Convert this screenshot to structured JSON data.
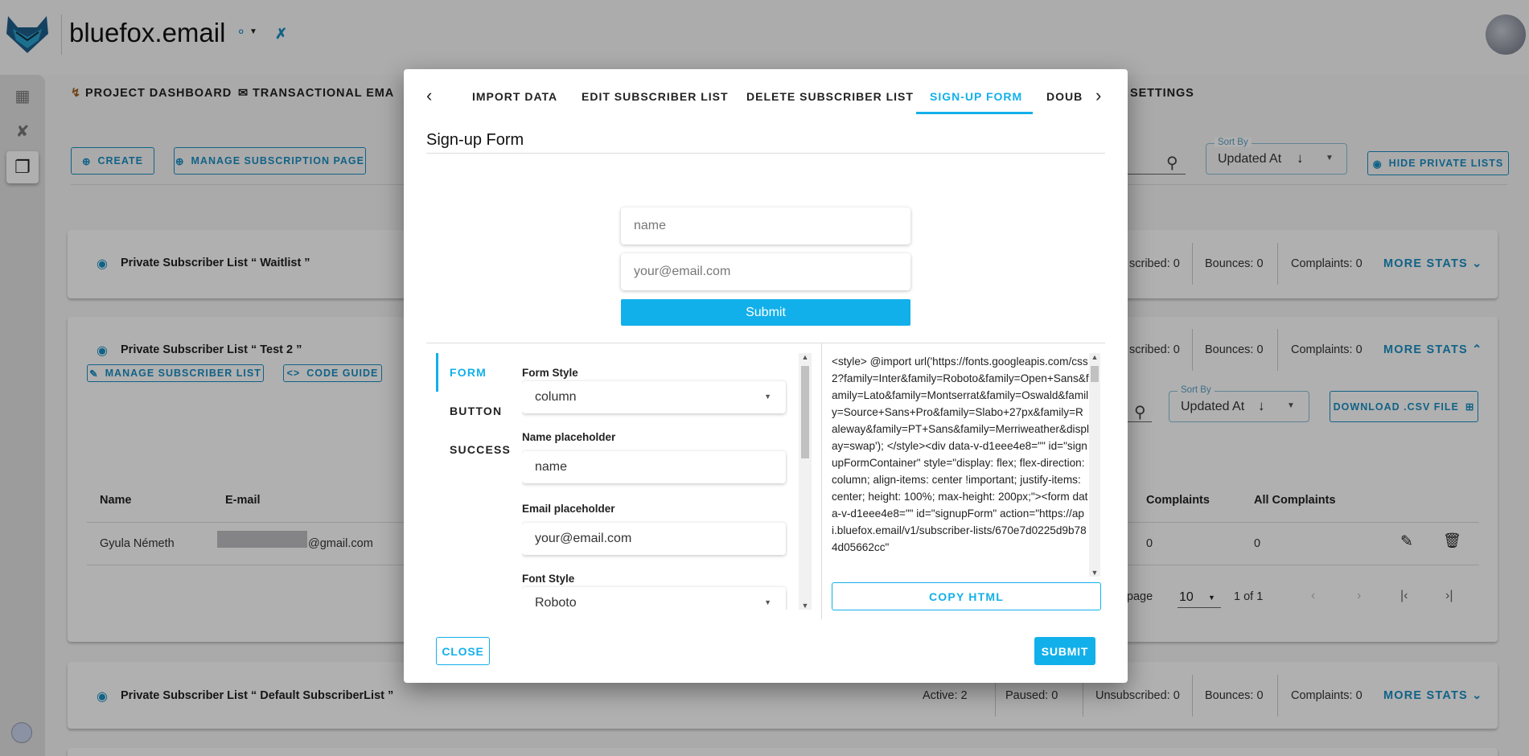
{
  "app": {
    "brand": "bluefox.email",
    "logo_icon": "fox-logo-icon",
    "accent": "#12b0ea"
  },
  "nav": {
    "items": [
      {
        "label": "PROJECT DASHBOARD",
        "icon": "chart-icon"
      },
      {
        "label": "TRANSACTIONAL EMA",
        "icon": "email-icon"
      },
      {
        "label": "SETTINGS"
      }
    ]
  },
  "toolbar": {
    "create": "CREATE",
    "manage_subscription_page": "MANAGE SUBSCRIPTION PAGE",
    "sort_label": "Sort By",
    "sort_value": "Updated At",
    "hide_private": "HIDE PRIVATE LISTS"
  },
  "lists": [
    {
      "title": "Private Subscriber List “ Waitlist ”",
      "unsubscribed": "scribed: 0",
      "bounces": "Bounces: 0",
      "complaints": "Complaints: 0",
      "more": "MORE STATS"
    },
    {
      "title": "Private Subscriber List “ Test 2 ”",
      "unsubscribed": "scribed: 0",
      "bounces": "Bounces: 0",
      "complaints": "Complaints: 0",
      "more": "MORE STATS",
      "manage": "MANAGE SUBSCRIBER LIST",
      "code_guide": "CODE GUIDE",
      "sort_label": "Sort By",
      "sort_value": "Updated At",
      "download": "DOWNLOAD .CSV FILE",
      "table": {
        "headers": [
          "Name",
          "E-mail",
          "Complaints",
          "All Complaints"
        ],
        "rows": [
          {
            "name": "Gyula Németh",
            "email": "@gmail.com",
            "complaints": "0",
            "all_complaints": "0"
          }
        ]
      },
      "pagination": {
        "rows_per_page_label": "er page",
        "rows_per_page": "10",
        "range": "1 of 1"
      }
    },
    {
      "title": "Private Subscriber List “ Default SubscriberList ”",
      "active": "Active: 2",
      "paused": "Paused: 0",
      "unsubscribed": "Unsubscribed: 0",
      "bounces": "Bounces: 0",
      "complaints": "Complaints: 0",
      "more": "MORE STATS"
    }
  ],
  "modal": {
    "tabs": [
      {
        "label": "IMPORT DATA",
        "active": false
      },
      {
        "label": "EDIT SUBSCRIBER LIST",
        "active": false
      },
      {
        "label": "DELETE SUBSCRIBER LIST",
        "active": false
      },
      {
        "label": "SIGN-UP FORM",
        "active": true
      },
      {
        "label": "DOUB",
        "active": false
      }
    ],
    "title": "Sign-up Form",
    "preview": {
      "name_placeholder": "name",
      "email_placeholder": "your@email.com",
      "submit": "Submit"
    },
    "side_tabs": [
      {
        "label": "FORM",
        "active": true
      },
      {
        "label": "BUTTON",
        "active": false
      },
      {
        "label": "SUCCESS",
        "active": false
      }
    ],
    "form": {
      "form_style_label": "Form Style",
      "form_style_value": "column",
      "name_label": "Name placeholder",
      "name_value": "name",
      "email_label": "Email placeholder",
      "email_value": "your@email.com",
      "font_label": "Font Style",
      "font_value": "Roboto"
    },
    "code": "<style> @import url('https://fonts.googleapis.com/css2?family=Inter&family=Roboto&family=Open+Sans&family=Lato&family=Montserrat&family=Oswald&family=Source+Sans+Pro&family=Slabo+27px&family=Raleway&family=PT+Sans&family=Merriweather&display=swap'); </style><div data-v-d1eee4e8=\"\" id=\"signupFormContainer\" style=\"display: flex; flex-direction: column; align-items: center !important; justify-items: center; height: 100%; max-height: 200px;\"><form data-v-d1eee4e8=\"\" id=\"signupForm\" action=\"https://api.bluefox.email/v1/subscriber-lists/670e7d0225d9b784d05662cc\"",
    "copy_html": "COPY HTML",
    "close": "CLOSE",
    "submit": "SUBMIT"
  }
}
